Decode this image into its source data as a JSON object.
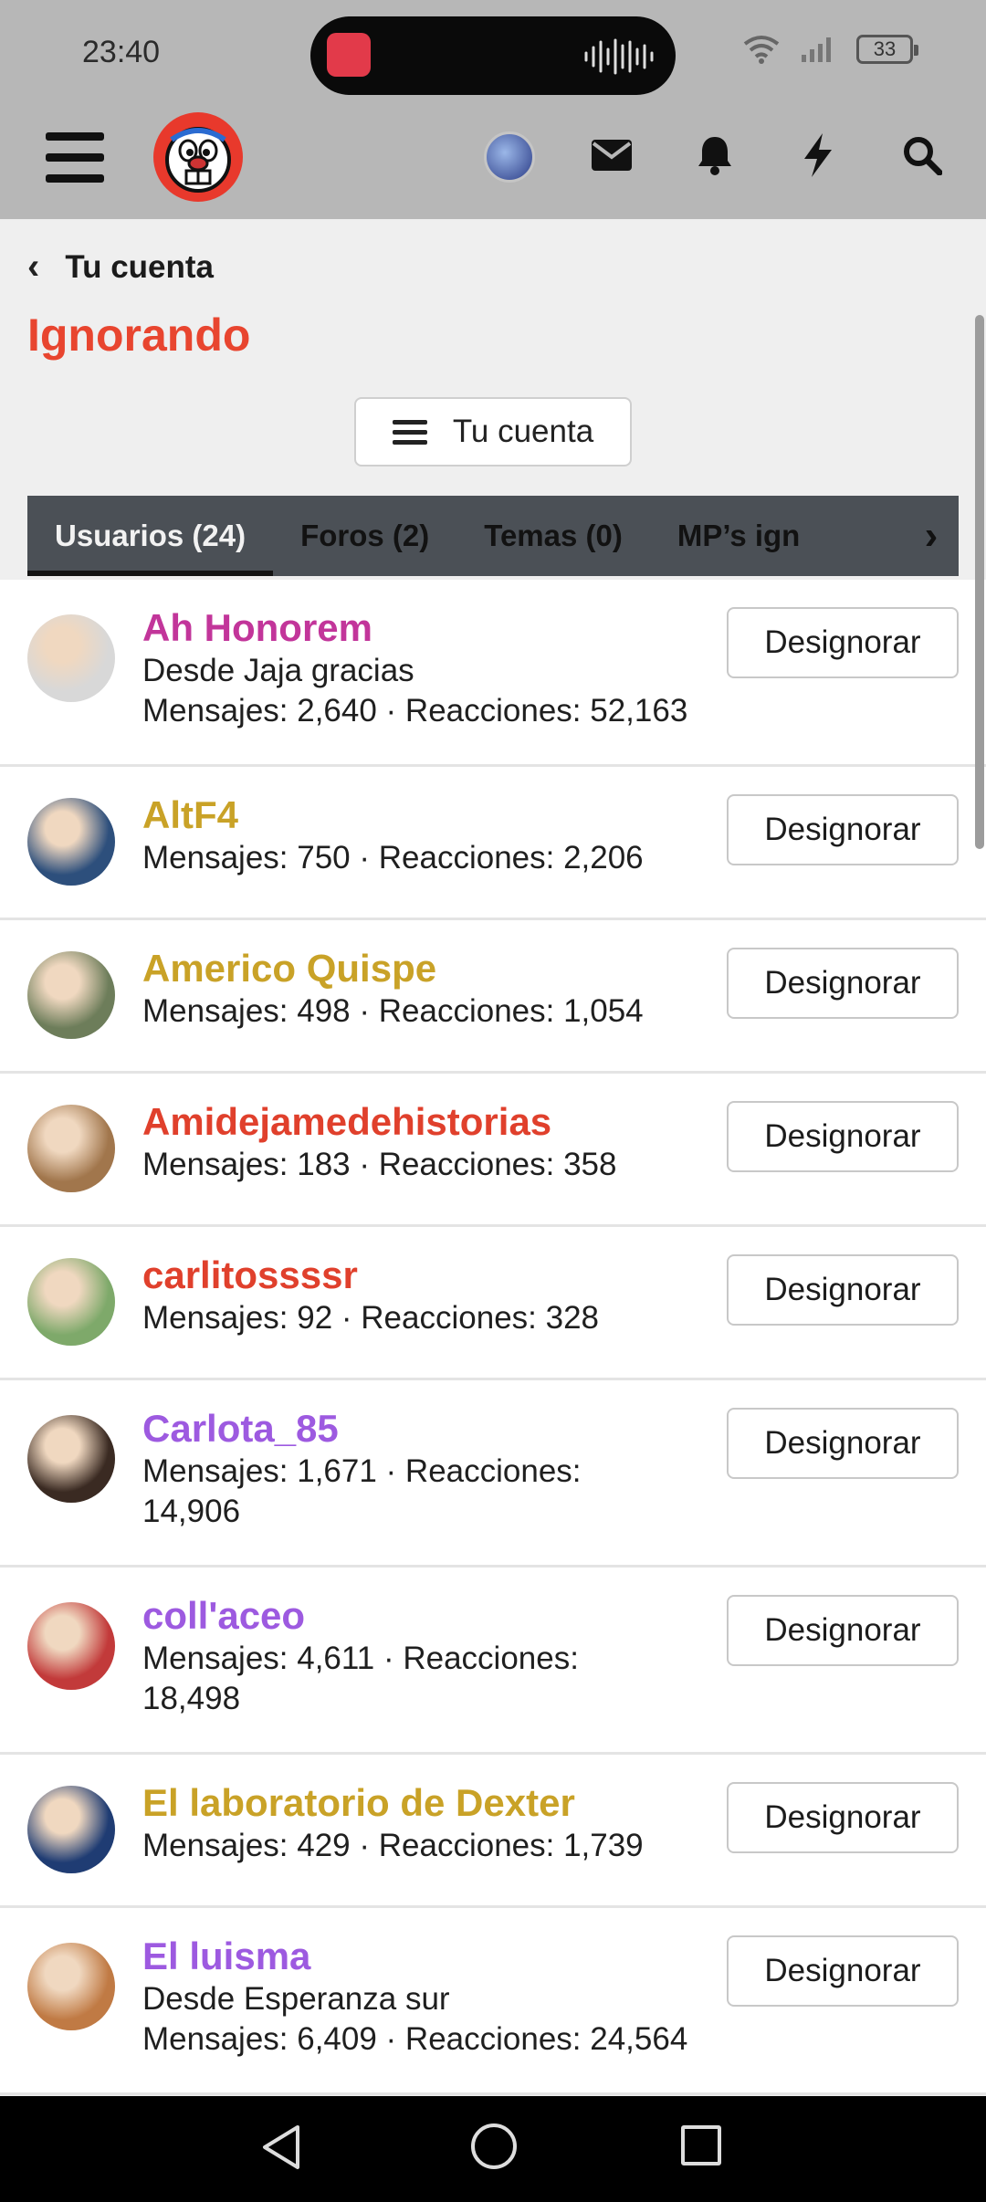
{
  "status_bar": {
    "time": "23:40",
    "battery": "33"
  },
  "header": {
    "menu_icon": "hamburger-icon",
    "logo": "forum-logo",
    "icons": [
      "user-avatar",
      "envelope-icon",
      "bell-icon",
      "lightning-icon",
      "search-icon"
    ]
  },
  "breadcrumb": {
    "label": "Tu cuenta"
  },
  "page": {
    "title": "Ignorando",
    "account_button_label": "Tu cuenta"
  },
  "tabs": [
    {
      "label": "Usuarios (24)",
      "active": true
    },
    {
      "label": "Foros (2)",
      "active": false
    },
    {
      "label": "Temas (0)",
      "active": false
    },
    {
      "label": "MP’s ign",
      "active": false
    }
  ],
  "colors": {
    "title": "#e8452f",
    "magenta": "#c2359a",
    "gold": "#c9a227",
    "red": "#e0402c",
    "purple": "#9d5ae0"
  },
  "users": [
    {
      "name": "Ah Honorem",
      "color": "#c2359a",
      "location": "Desde Jaja gracias",
      "meta1": "Mensajes: 2,640 · Reacciones: 52,163",
      "meta2": "",
      "avatar": "#d8d8d8"
    },
    {
      "name": "AltF4",
      "color": "#c9a227",
      "location": "",
      "meta1": "Mensajes: 750 · Reacciones: 2,206",
      "meta2": "",
      "avatar": "#2d4f7c"
    },
    {
      "name": "Americo Quispe",
      "color": "#c9a227",
      "location": "",
      "meta1": "Mensajes: 498 · Reacciones: 1,054",
      "meta2": "",
      "avatar": "#6d7d5a"
    },
    {
      "name": "Amidejamedehistorias",
      "color": "#e0402c",
      "location": "",
      "meta1": "Mensajes: 183 · Reacciones: 358",
      "meta2": "",
      "avatar": "#a1764c"
    },
    {
      "name": "carlitossssr",
      "color": "#e0402c",
      "location": "",
      "meta1": "Mensajes: 92 · Reacciones: 328",
      "meta2": "",
      "avatar": "#7ea96a"
    },
    {
      "name": "Carlota_85",
      "color": "#9d5ae0",
      "location": "",
      "meta1": "Mensajes: 1,671 · Reacciones:",
      "meta2": "14,906",
      "avatar": "#3a2a22"
    },
    {
      "name": "coll'aceo",
      "color": "#9d5ae0",
      "location": "",
      "meta1": "Mensajes: 4,611 · Reacciones:",
      "meta2": "18,498",
      "avatar": "#c23a3a"
    },
    {
      "name": "El laboratorio de Dexter",
      "color": "#c9a227",
      "location": "",
      "meta1": "Mensajes: 429 · Reacciones: 1,739",
      "meta2": "",
      "avatar": "#1f3c73"
    },
    {
      "name": "El luisma",
      "color": "#9d5ae0",
      "location": "Desde Esperanza sur",
      "meta1": "Mensajes: 6,409 · Reacciones: 24,564",
      "meta2": "",
      "avatar": "#c07a44"
    }
  ],
  "unignore_label": "Designorar"
}
